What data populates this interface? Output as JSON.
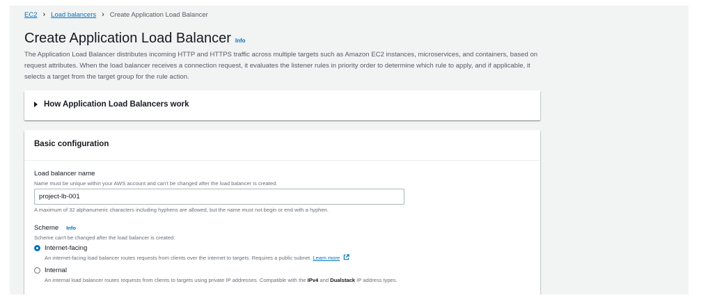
{
  "breadcrumb": {
    "items": [
      "EC2",
      "Load balancers"
    ],
    "current": "Create Application Load Balancer"
  },
  "page": {
    "title": "Create Application Load Balancer",
    "info": "Info",
    "description": "The Application Load Balancer distributes incoming HTTP and HTTPS traffic across multiple targets such as Amazon EC2 instances, microservices, and containers, based on request attributes. When the load balancer receives a connection request, it evaluates the listener rules in priority order to determine which rule to apply, and if applicable, it selects a target from the target group for the rule action."
  },
  "how_it_works": {
    "label": "How Application Load Balancers work"
  },
  "basic_config": {
    "title": "Basic configuration",
    "name_field": {
      "label": "Load balancer name",
      "description": "Name must be unique within your AWS account and can't be changed after the load balancer is created.",
      "value": "project-lb-001",
      "constraint": "A maximum of 32 alphanumeric characters including hyphens are allowed, but the name must not begin or end with a hyphen."
    },
    "scheme": {
      "label": "Scheme",
      "info": "Info",
      "description": "Scheme can't be changed after the load balancer is created.",
      "options": [
        {
          "label": "Internet-facing",
          "description": "An internet-facing load balancer routes requests from clients over the internet to targets. Requires a public subnet.",
          "link": "Learn more",
          "selected": true
        },
        {
          "label": "Internal",
          "description_pre": "An internal load balancer routes requests from clients to targets using private IP addresses. Compatible with the ",
          "description_b1": "IPv4",
          "description_mid": " and ",
          "description_b2": "Dualstack",
          "description_post": " IP address types.",
          "selected": false
        }
      ]
    }
  },
  "colors": {
    "link": "#0073bb",
    "background": "#f2f3f3",
    "text": "#16191f",
    "muted": "#687078"
  },
  "icons": {
    "external_link": "external-link-icon",
    "caret": "caret-right-icon"
  }
}
